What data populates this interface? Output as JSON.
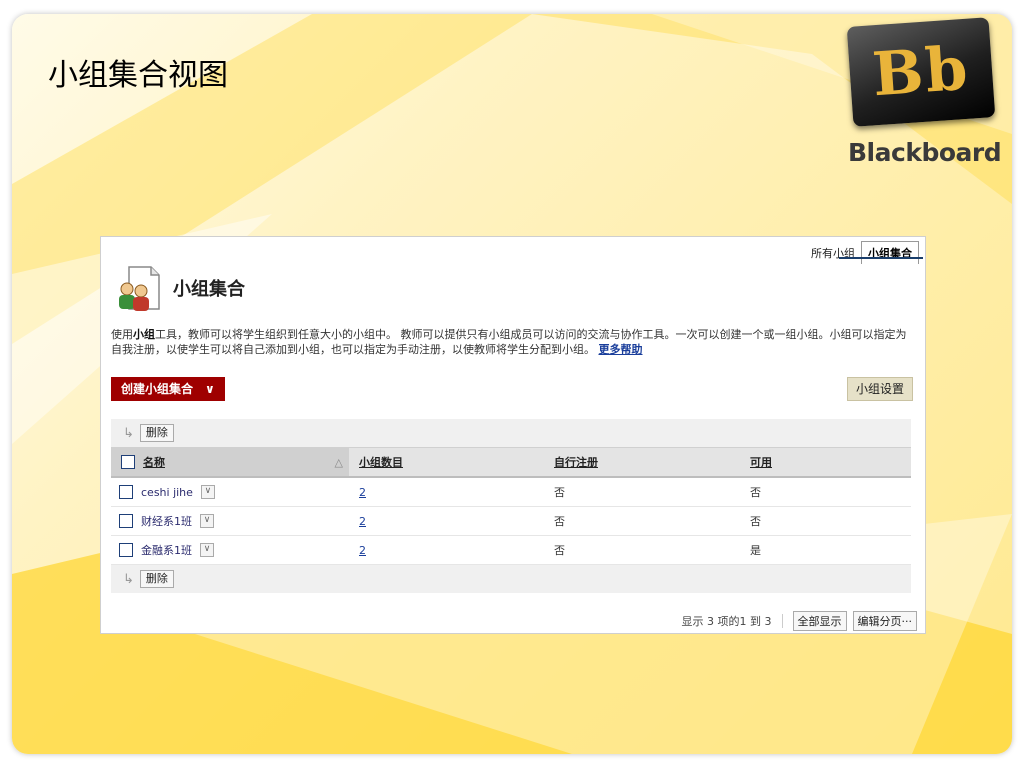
{
  "slide": {
    "title": "小组集合视图",
    "logo_letters": "Bb",
    "logo_text": "Blackboard"
  },
  "tabs": [
    {
      "label": "所有小组"
    },
    {
      "label": "小组集合"
    }
  ],
  "page": {
    "heading": "小组集合",
    "description_pre": "使用",
    "description_bold": "小组",
    "description_rest": "工具，教师可以将学生组织到任意大小的小组中。 教师可以提供只有小组成员可以访问的交流与协作工具。一次可以创建一个或一组小组。小组可以指定为自我注册，以使学生可以将自己添加到小组，也可以指定为手动注册，以使教师将学生分配到小组。",
    "help_link": "更多帮助"
  },
  "toolbar": {
    "create_label": "创建小组集合",
    "create_chevron": "»",
    "settings_label": "小组设置"
  },
  "grid": {
    "delete_label": "删除",
    "headers": {
      "name": "名称",
      "count": "小组数目",
      "self_enroll": "自行注册",
      "available": "可用"
    },
    "rows": [
      {
        "name": "ceshi jihe",
        "count": "2",
        "self_enroll": "否",
        "available": "否"
      },
      {
        "name": "财经系1班",
        "count": "2",
        "self_enroll": "否",
        "available": "否"
      },
      {
        "name": "金融系1班",
        "count": "2",
        "self_enroll": "否",
        "available": "是"
      }
    ]
  },
  "paging": {
    "text": "显示 3 项的1 到 3",
    "show_all": "全部显示",
    "edit_paging": "编辑分页···"
  }
}
